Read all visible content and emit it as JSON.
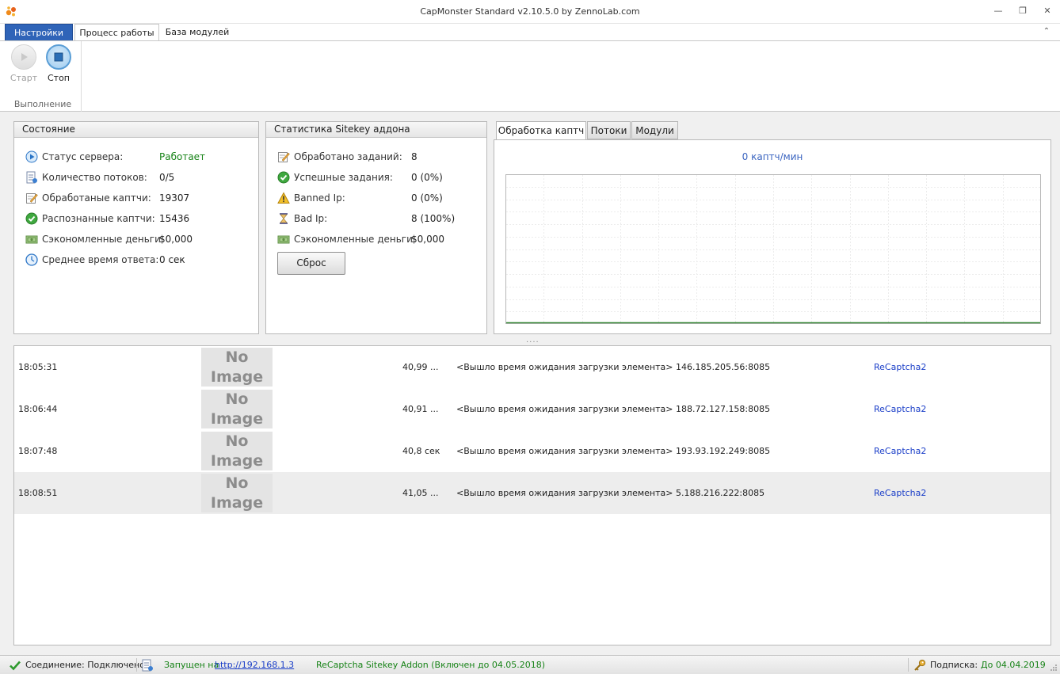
{
  "window": {
    "title": "CapMonster Standard v2.10.5.0 by ZennoLab.com",
    "controls": {
      "minimize": "—",
      "restore": "❐",
      "close": "✕"
    }
  },
  "ribbon": {
    "tabs": {
      "app": "Настройки",
      "active": "Процесс работы",
      "other": "База модулей"
    },
    "buttons": {
      "start": "Старт",
      "stop": "Стоп"
    },
    "group_label": "Выполнение"
  },
  "state_panel": {
    "title": "Состояние",
    "rows": [
      {
        "label": "Статус сервера:",
        "value": "Работает",
        "icon": "play-circle-icon"
      },
      {
        "label": "Количество потоков:",
        "value": "0/5",
        "icon": "threads-icon"
      },
      {
        "label": "Обработаные каптчи:",
        "value": "19307",
        "icon": "edit-icon"
      },
      {
        "label": "Распознанные каптчи:",
        "value": "15436",
        "icon": "check-circle-icon"
      },
      {
        "label": "Сэкономленные деньги:",
        "value": "$0,000",
        "icon": "money-icon"
      },
      {
        "label": "Среднее время ответа:",
        "value": "0 сек",
        "icon": "clock-icon"
      }
    ]
  },
  "sitekey_panel": {
    "title": "Статистика Sitekey аддона",
    "rows": [
      {
        "label": "Обработано заданий:",
        "value": "8",
        "icon": "edit-icon"
      },
      {
        "label": "Успешные задания:",
        "value": "0 (0%)",
        "icon": "check-circle-icon"
      },
      {
        "label": "Banned Ip:",
        "value": "0 (0%)",
        "icon": "warning-icon"
      },
      {
        "label": "Bad Ip:",
        "value": "8 (100%)",
        "icon": "hourglass-icon"
      },
      {
        "label": "Сэкономленные деньги:",
        "value": "$0,000",
        "icon": "money-icon"
      }
    ],
    "reset_label": "Сброс"
  },
  "chart_tabs": [
    "Обработка каптч",
    "Потоки",
    "Модули"
  ],
  "chart_data": {
    "type": "line",
    "title": "0 каптч/мин",
    "series": [
      {
        "values": [
          0,
          0,
          0,
          0,
          0,
          0,
          0,
          0,
          0,
          0,
          0,
          0,
          0,
          0
        ]
      }
    ],
    "grid": true,
    "line_color": "#3a8a3a"
  },
  "splitter": "....",
  "log": {
    "no_image": "No Image",
    "rows": [
      {
        "time": "18:05:31",
        "duration": "40,99 ...",
        "message": "<Вышло время ожидания загрузки элемента>  146.185.205.56:8085",
        "type": "ReCaptcha2",
        "selected": false
      },
      {
        "time": "18:06:44",
        "duration": "40,91 ...",
        "message": "<Вышло время ожидания загрузки элемента>  188.72.127.158:8085",
        "type": "ReCaptcha2",
        "selected": false
      },
      {
        "time": "18:07:48",
        "duration": "40,8 сек",
        "message": "<Вышло время ожидания загрузки элемента>  193.93.192.249:8085",
        "type": "ReCaptcha2",
        "selected": false
      },
      {
        "time": "18:08:51",
        "duration": "41,05 ...",
        "message": " <Вышло время ожидания загрузки элемента>  5.188.216.222:8085",
        "type": "ReCaptcha2",
        "selected": true
      }
    ]
  },
  "statusbar": {
    "connection": "Соединение: Подключено",
    "running_prefix": "Запущен на ",
    "running_link": "http://192.168.1.3",
    "addon": "ReCaptcha Sitekey Addon (Включен до 04.05.2018)",
    "subscription_label": "Подписка:",
    "subscription_value": "До 04.04.2019"
  },
  "colors": {
    "accent": "#2f64b8",
    "green": "#178317",
    "link": "#1a3ec8"
  }
}
